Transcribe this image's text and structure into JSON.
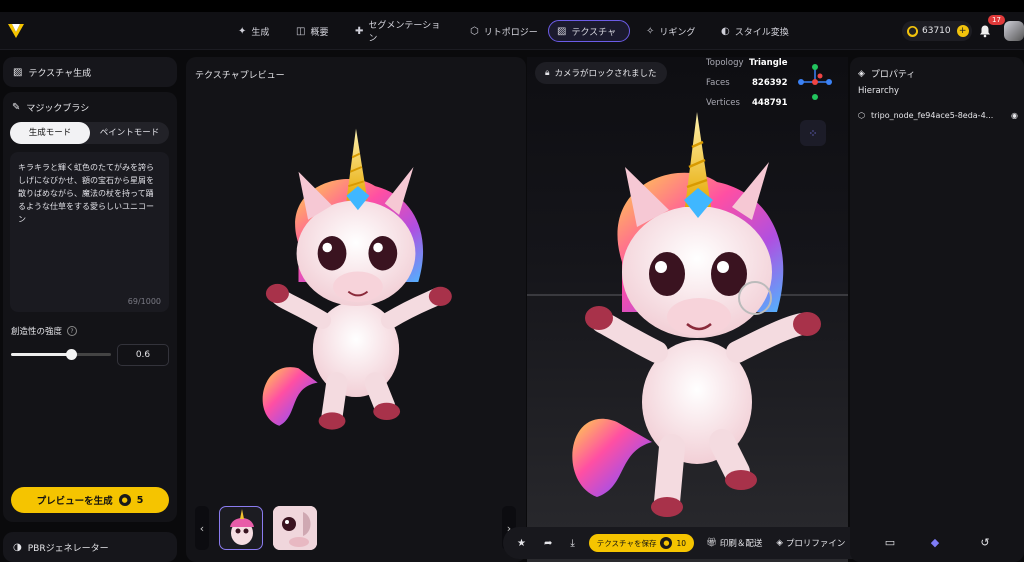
{
  "nav": {
    "items": [
      {
        "icon": "sparkle-icon",
        "glyph": "✦",
        "label": "生成"
      },
      {
        "icon": "frame-icon",
        "glyph": "◫",
        "label": "概要"
      },
      {
        "icon": "puzzle-icon",
        "glyph": "✚",
        "label": "セグメンテーション"
      },
      {
        "icon": "cube-icon",
        "glyph": "⬡",
        "label": "リトポロジー"
      },
      {
        "icon": "texture-icon",
        "glyph": "▨",
        "label": "テクスチャ"
      },
      {
        "icon": "figure-icon",
        "glyph": "✧",
        "label": "リギング"
      },
      {
        "icon": "palette-icon",
        "glyph": "◐",
        "label": "スタイル変換"
      }
    ],
    "active_index": 4,
    "coins": "63710",
    "notifications": "17"
  },
  "left": {
    "header": "テクスチャ生成",
    "brush_title": "マジックブラシ",
    "mode_generate": "生成モード",
    "mode_paint": "ペイントモード",
    "prompt": "キラキラと輝く虹色のたてがみを誇らしげになびかせ、額の宝石から星屑を散りばめながら、魔法の杖を持って踊るような仕草をする愛らしいユニコーン",
    "counter": "69/1000",
    "strength_label": "創造性の強度",
    "strength_value": "0.6",
    "strength_fraction": 0.6,
    "generate_button": "プレビューを生成",
    "generate_cost": "5",
    "pbr_label": "PBRジェネレーター"
  },
  "preview": {
    "title": "テクスチャプレビュー"
  },
  "viewport": {
    "lock_message": "カメラがロックされました",
    "topology_label": "Topology",
    "topology_value": "Triangle",
    "faces_label": "Faces",
    "faces_value": "826392",
    "vertices_label": "Vertices",
    "vertices_value": "448791"
  },
  "toolbar": {
    "save_label": "テクスチャを保存",
    "save_cost": "10",
    "print_label": "印刷＆配送",
    "profile_label": "プロリファイン"
  },
  "properties": {
    "title": "プロパティ",
    "hierarchy": "Hierarchy",
    "node": "tripo_node_fe94ace5-8eda-4..."
  },
  "colors": {
    "accent_yellow": "#f5c400",
    "active_tab_border": "#6c5ce7",
    "badge_red": "#e03a3a"
  }
}
